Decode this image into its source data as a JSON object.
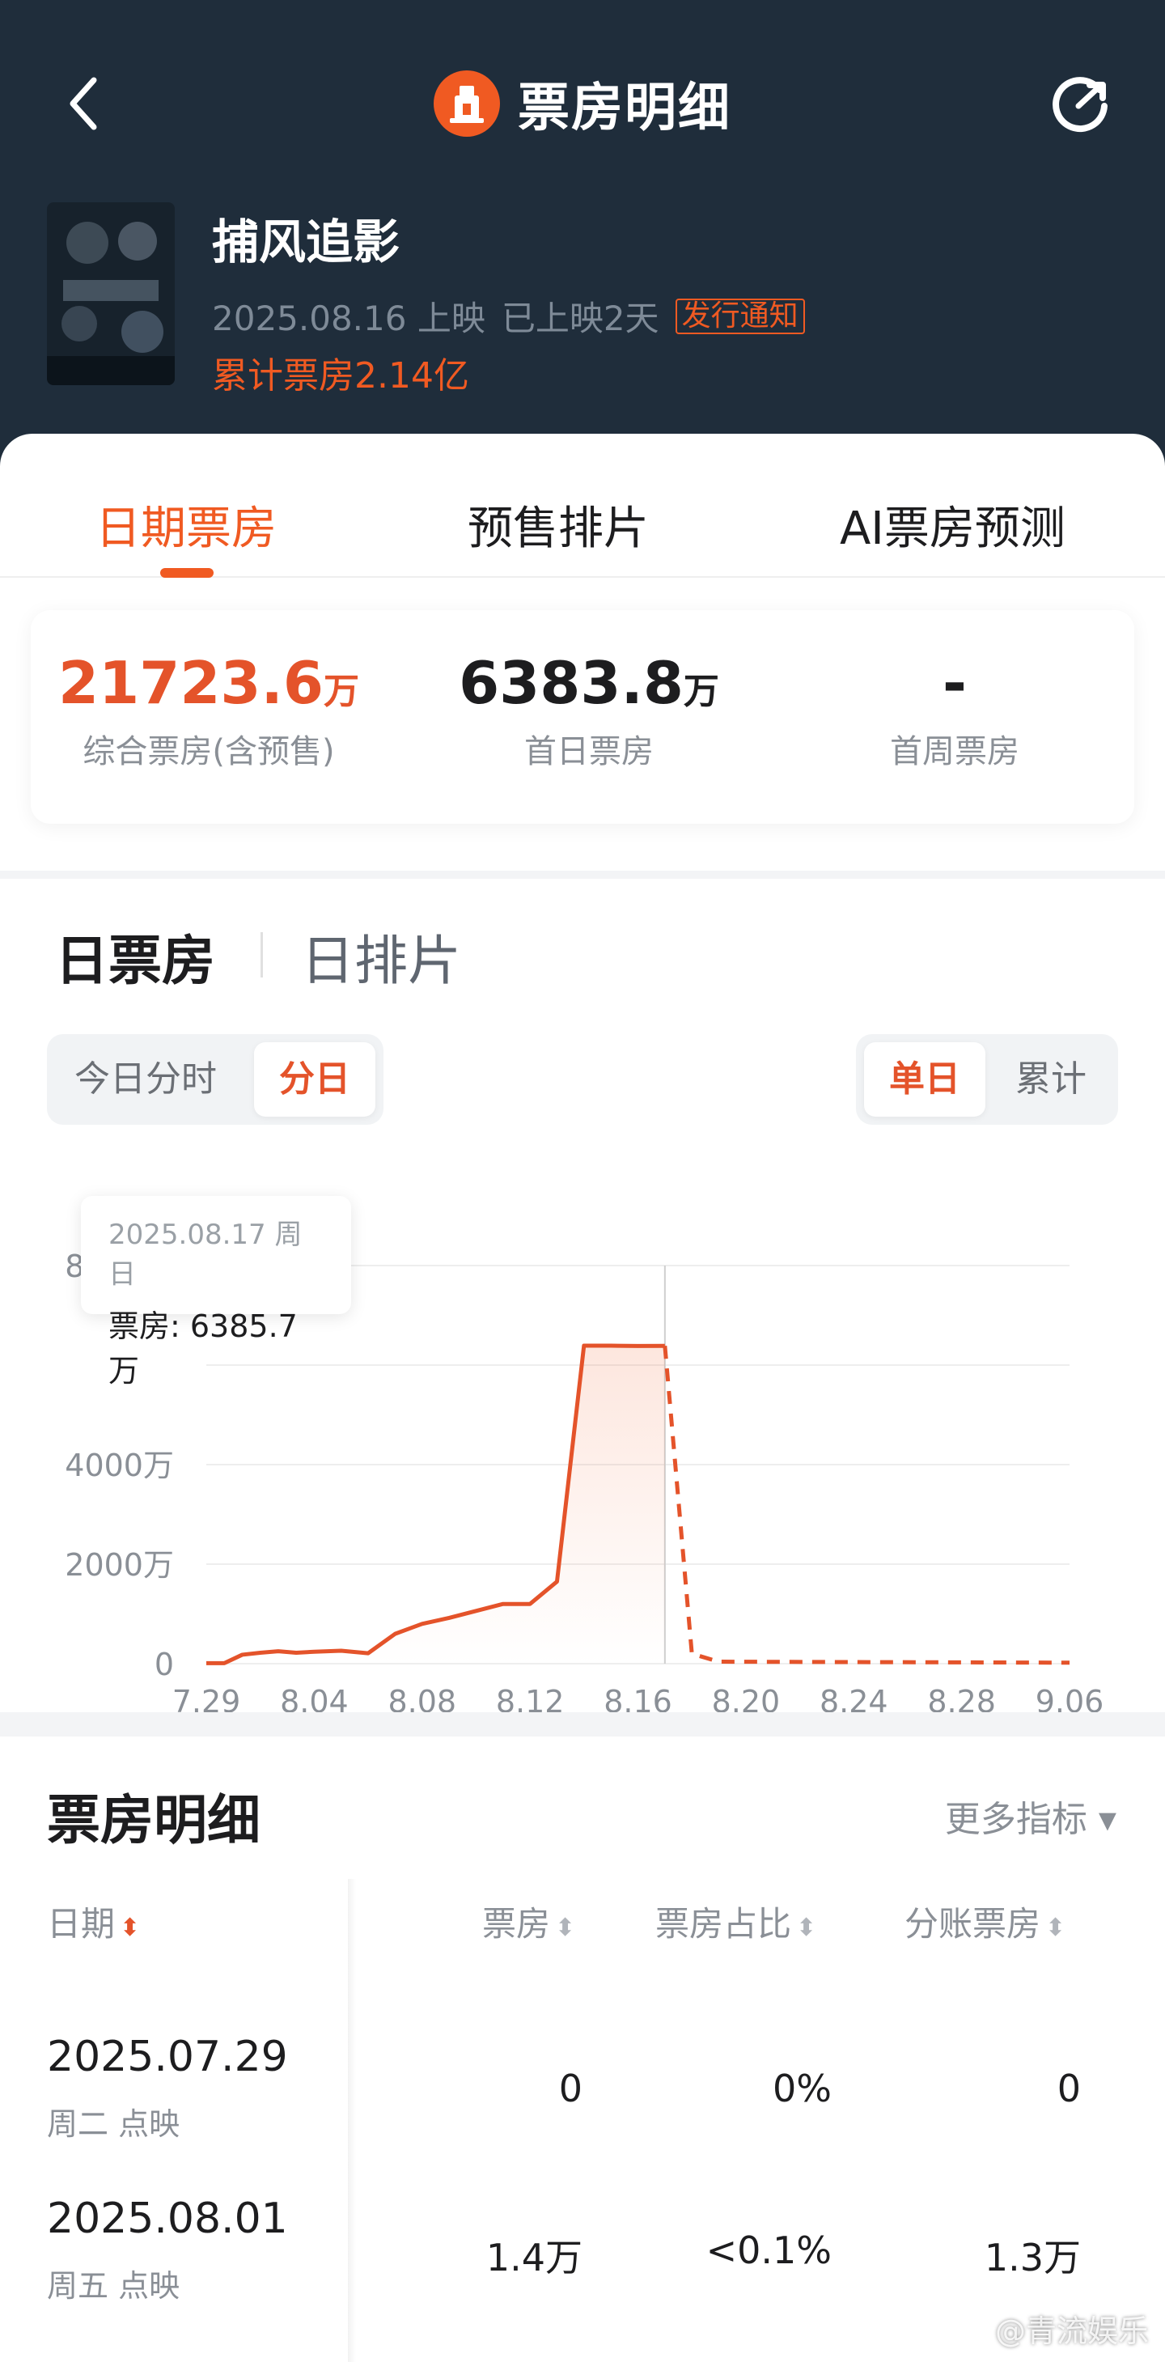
{
  "nav": {
    "title": "票房明细"
  },
  "movie": {
    "title": "捕风追影",
    "release": "2025.08.16 上映",
    "days": "已上映2天",
    "tag": "发行通知",
    "cumulative": "累计票房2.14亿"
  },
  "tabs": [
    "日期票房",
    "预售排片",
    "AI票房预测"
  ],
  "stats": [
    {
      "value": "21723.6",
      "unit": "万",
      "label": "综合票房(含预售)"
    },
    {
      "value": "6383.8",
      "unit": "万",
      "label": "首日票房"
    },
    {
      "value": "-",
      "unit": "",
      "label": "首周票房"
    }
  ],
  "chart_section": {
    "tabs": [
      "日票房",
      "日排片"
    ],
    "seg_left": [
      "今日分时",
      "分日"
    ],
    "seg_right": [
      "单日",
      "累计"
    ]
  },
  "tooltip": {
    "date": "2025.08.17 周日",
    "value": "票房: 6385.7万"
  },
  "chart_data": {
    "type": "line",
    "ylim": [
      0,
      8000
    ],
    "y_ticks": [
      "0",
      "2000万",
      "4000万",
      "",
      "8000万"
    ],
    "x_ticks": [
      "7.29",
      "8.04",
      "8.08",
      "8.12",
      "8.16",
      "8.20",
      "8.24",
      "8.28",
      "9.06"
    ],
    "series": [
      {
        "style": "solid",
        "x": [
          "7.29",
          "7.30",
          "7.31",
          "8.01",
          "8.02",
          "8.03",
          "8.04",
          "8.05",
          "8.06",
          "8.07",
          "8.08",
          "8.09",
          "8.10",
          "8.11",
          "8.12",
          "8.13",
          "8.14",
          "8.15",
          "8.16",
          "8.17"
        ],
        "values": [
          10,
          10,
          180,
          220,
          250,
          220,
          240,
          260,
          210,
          600,
          800,
          920,
          1060,
          1200,
          1200,
          1650,
          6390,
          6390,
          6384,
          6386
        ]
      },
      {
        "style": "dashed",
        "x": [
          "8.17",
          "8.18",
          "8.19",
          "9.06"
        ],
        "values": [
          6386,
          200,
          40,
          20
        ]
      }
    ],
    "highlight": "8.17"
  },
  "detail": {
    "title": "票房明细",
    "more": "更多指标 ▾",
    "headers": [
      "日期",
      "票房",
      "票房占比",
      "分账票房"
    ],
    "rows": [
      {
        "date": "2025.07.29",
        "sub": "周二 点映",
        "box": "0",
        "share": "0%",
        "split": "0"
      },
      {
        "date": "2025.08.01",
        "sub": "周五 点映",
        "box": "1.4万",
        "share": "<0.1%",
        "split": "1.3万"
      }
    ]
  },
  "watermark": "@青流娱乐",
  "colors": {
    "accent": "#f05a22",
    "header_bg": "#1f2d3b"
  }
}
